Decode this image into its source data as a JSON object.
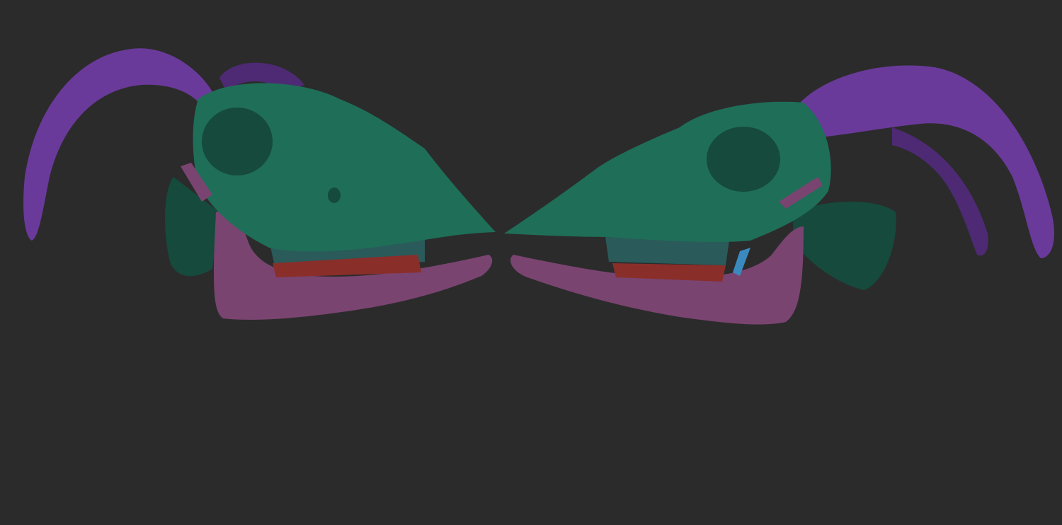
{
  "colors": {
    "background": "#2b2b2b",
    "horn": "#6a3a9a",
    "horn_dark": "#4e2a74",
    "cranium": "#1f6e58",
    "cranium_dark": "#154a3c",
    "jaw": "#7a4470",
    "jaw_dark": "#5a3052",
    "teeth": "#2a5a5a",
    "gums": "#8a2e2a",
    "tongue_accent": "#3a8ac0"
  }
}
